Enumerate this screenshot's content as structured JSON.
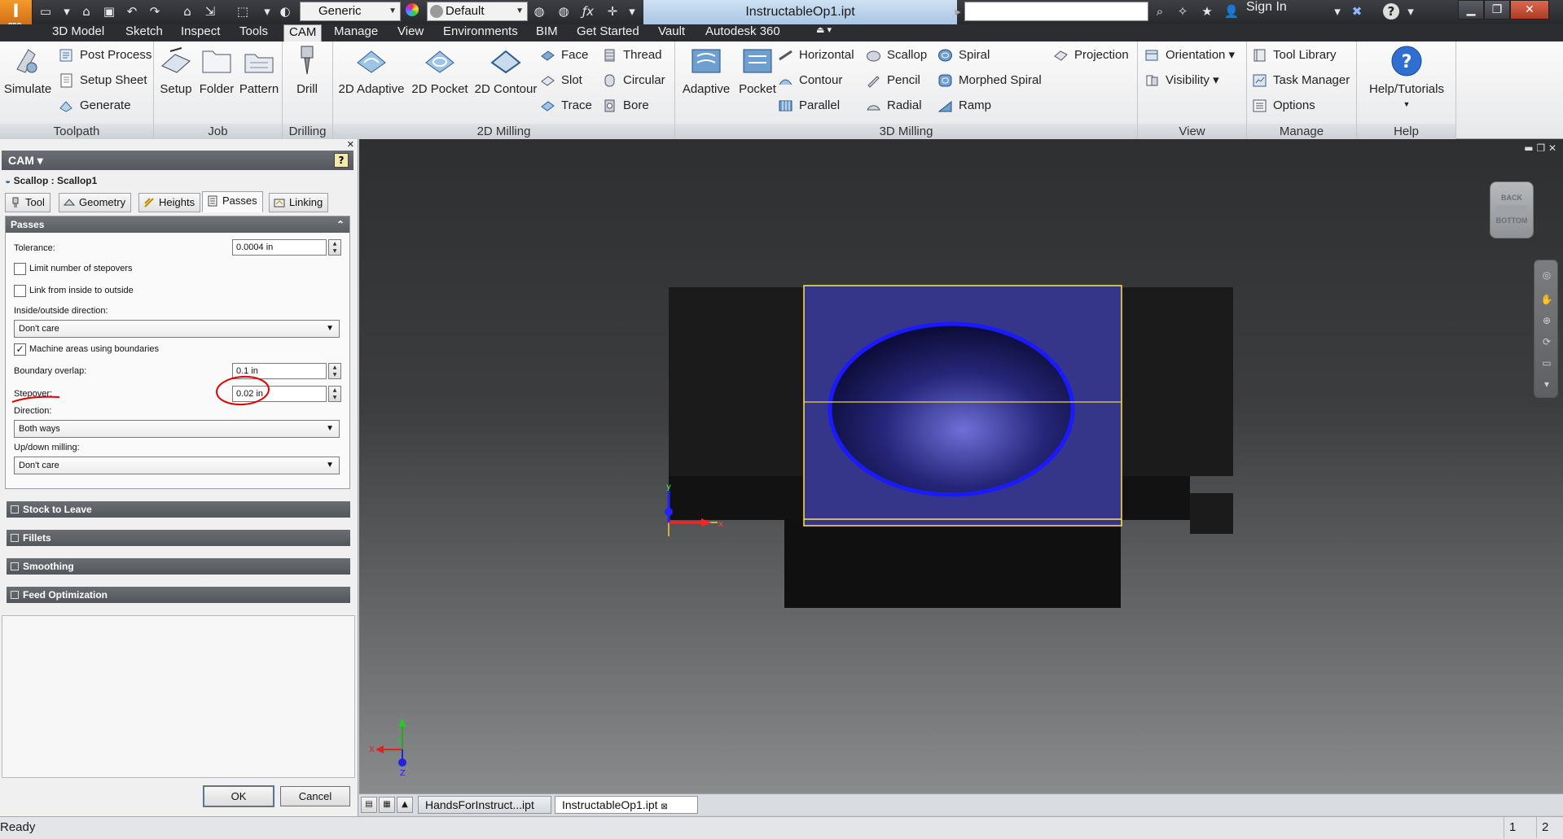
{
  "app": {
    "badge": "I",
    "badge_sub": "PRO"
  },
  "titlebar": {
    "style_combo": "Generic",
    "material_combo": "Default",
    "document_title": "InstructableOp1.ipt",
    "sign_in": "Sign In",
    "help_icon": "?",
    "icons": [
      "new-file-icon",
      "open-icon",
      "save-icon",
      "undo-icon",
      "redo-icon",
      "home-icon",
      "return-icon",
      "select-icon",
      "appearance-icon",
      "color-ball-icon",
      "fx-icon",
      "plus-icon",
      "dropdown-icon"
    ]
  },
  "tabs": [
    "3D Model",
    "Sketch",
    "Inspect",
    "Tools",
    "CAM",
    "Manage",
    "View",
    "Environments",
    "BIM",
    "Get Started",
    "Vault",
    "Autodesk 360"
  ],
  "active_tab": "CAM",
  "ribbon": {
    "toolpath": {
      "label": "Toolpath",
      "simulate": "Simulate",
      "post_process": "Post Process",
      "setup_sheet": "Setup Sheet",
      "generate": "Generate"
    },
    "job": {
      "label": "Job",
      "setup": "Setup",
      "folder": "Folder",
      "pattern": "Pattern"
    },
    "drilling": {
      "label": "Drilling",
      "drill": "Drill"
    },
    "milling_2d": {
      "label": "2D Milling",
      "adaptive": "2D Adaptive",
      "pocket": "2D Pocket",
      "contour": "2D Contour",
      "face": "Face",
      "slot": "Slot",
      "trace": "Trace",
      "thread": "Thread",
      "circular": "Circular",
      "bore": "Bore"
    },
    "milling_3d": {
      "label": "3D Milling",
      "adaptive": "Adaptive",
      "pocket": "Pocket",
      "horizontal": "Horizontal",
      "contour": "Contour",
      "parallel": "Parallel",
      "scallop": "Scallop",
      "pencil": "Pencil",
      "radial": "Radial",
      "spiral": "Spiral",
      "morphed_spiral": "Morphed Spiral",
      "ramp": "Ramp",
      "projection": "Projection"
    },
    "view": {
      "label": "View",
      "orientation": "Orientation",
      "visibility": "Visibility"
    },
    "manage": {
      "label": "Manage",
      "tool_library": "Tool Library",
      "task_manager": "Task Manager",
      "options": "Options"
    },
    "help": {
      "label": "Help",
      "help_tutorials": "Help/Tutorials"
    }
  },
  "cam_panel": {
    "header": "CAM",
    "operation": "Scallop : Scallop1",
    "tabs": [
      "Tool",
      "Geometry",
      "Heights",
      "Passes",
      "Linking"
    ],
    "active_tab": "Passes",
    "passes": {
      "section": "Passes",
      "tolerance_label": "Tolerance:",
      "tolerance_value": "0.0004 in",
      "limit_stepovers": "Limit number of stepovers",
      "limit_stepovers_checked": false,
      "link_inside": "Link from inside to outside",
      "link_inside_checked": false,
      "inside_outside_label": "Inside/outside direction:",
      "inside_outside_value": "Don't care",
      "machine_areas": "Machine areas using boundaries",
      "machine_areas_checked": true,
      "boundary_overlap_label": "Boundary overlap:",
      "boundary_overlap_value": "0.1 in",
      "stepover_label": "Stepover:",
      "stepover_value": "0.02 in",
      "direction_label": "Direction:",
      "direction_value": "Both ways",
      "updown_label": "Up/down milling:",
      "updown_value": "Don't care"
    },
    "sections": [
      "Stock to Leave",
      "Fillets",
      "Smoothing",
      "Feed Optimization"
    ],
    "ok": "OK",
    "cancel": "Cancel"
  },
  "viewport": {
    "viewcube_top": "BACK",
    "viewcube_bottom": "BOTTOM",
    "axis_x": "X",
    "axis_y": "Y",
    "axis_z": "Z",
    "colors": {
      "part": "#1b1b1b",
      "selection": "#ffe84a",
      "surface": "#35358a",
      "boundary": "#1a1aff"
    }
  },
  "doc_tabs": [
    "HandsForInstruct...ipt",
    "InstructableOp1.ipt"
  ],
  "status": {
    "text": "Ready",
    "page_a": "1",
    "page_b": "2"
  }
}
